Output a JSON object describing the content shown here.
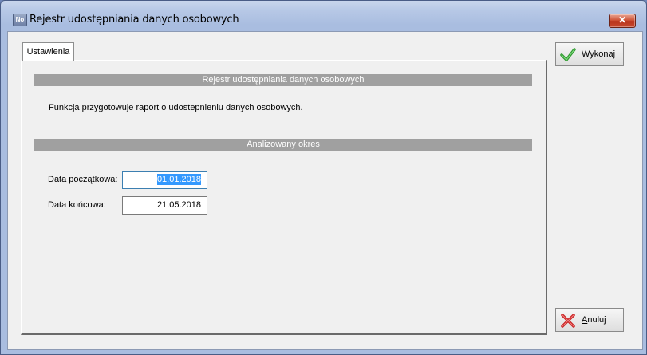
{
  "window": {
    "title": "Rejestr udostępniania danych osobowych",
    "app_icon_text": "No",
    "close_label": "✕"
  },
  "tabs": [
    {
      "label": "Ustawienia",
      "active": true
    }
  ],
  "panel": {
    "section1_title": "Rejestr udostępniania danych osobowych",
    "description": "Funkcja przygotowuje raport o udostepnieniu danych osobowych.",
    "section2_title": "Analizowany okres",
    "start_date_label": "Data początkowa:",
    "start_date_value": "01.01.2018",
    "end_date_label": "Data końcowa:",
    "end_date_value": "21.05.2018"
  },
  "buttons": {
    "execute_label": "Wykonaj",
    "cancel_label_first": "A",
    "cancel_label_rest": "nuluj"
  },
  "colors": {
    "section_bar": "#a0a0a0",
    "check_green": "#3aa53a",
    "cancel_red": "#d22a2a",
    "selection": "#3399ff"
  }
}
